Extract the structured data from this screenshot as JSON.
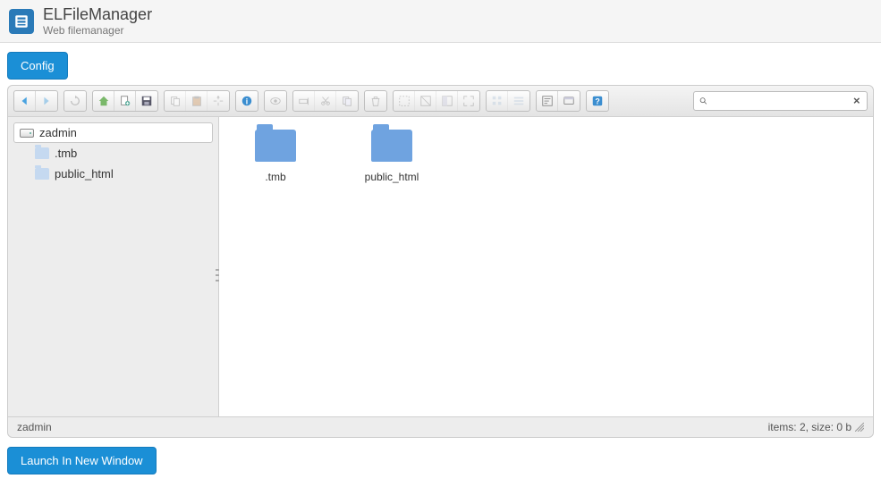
{
  "app": {
    "title": "ELFileManager",
    "subtitle": "Web filemanager"
  },
  "buttons": {
    "config": "Config",
    "launch": "Launch In New Window"
  },
  "toolbar": {
    "groups": [
      [
        {
          "name": "back-icon",
          "svg": "arrow-left",
          "enabled": true
        },
        {
          "name": "forward-icon",
          "svg": "arrow-right",
          "enabled": false
        }
      ],
      [
        {
          "name": "reload-icon",
          "svg": "reload",
          "enabled": false
        }
      ],
      [
        {
          "name": "home-icon",
          "svg": "home",
          "enabled": true
        },
        {
          "name": "new-file-icon",
          "svg": "newfile",
          "enabled": true
        },
        {
          "name": "save-icon",
          "svg": "save",
          "enabled": true
        }
      ],
      [
        {
          "name": "copy-icon",
          "svg": "copy",
          "enabled": false
        },
        {
          "name": "paste-icon",
          "svg": "paste",
          "enabled": false
        },
        {
          "name": "move-icon",
          "svg": "move",
          "enabled": false
        }
      ],
      [
        {
          "name": "info-icon",
          "svg": "info",
          "enabled": true
        }
      ],
      [
        {
          "name": "preview-icon",
          "svg": "eye",
          "enabled": false
        }
      ],
      [
        {
          "name": "rename-icon",
          "svg": "rename",
          "enabled": false
        },
        {
          "name": "cut-icon",
          "svg": "cut",
          "enabled": false
        },
        {
          "name": "duplicate-icon",
          "svg": "dup",
          "enabled": false
        }
      ],
      [
        {
          "name": "delete-icon",
          "svg": "trash",
          "enabled": false
        }
      ],
      [
        {
          "name": "select-all-icon",
          "svg": "selall",
          "enabled": false
        },
        {
          "name": "select-none-icon",
          "svg": "selnone",
          "enabled": false
        },
        {
          "name": "invert-selection-icon",
          "svg": "selinv",
          "enabled": false
        },
        {
          "name": "fullscreen-icon",
          "svg": "full",
          "enabled": false
        }
      ],
      [
        {
          "name": "view-icons-icon",
          "svg": "grid",
          "enabled": false
        },
        {
          "name": "view-list-icon",
          "svg": "list",
          "enabled": false
        }
      ],
      [
        {
          "name": "sort-icon",
          "svg": "sort",
          "enabled": true
        },
        {
          "name": "view-mode-icon",
          "svg": "view",
          "enabled": true
        }
      ],
      [
        {
          "name": "help-icon",
          "svg": "help",
          "enabled": true
        }
      ]
    ],
    "search_placeholder": ""
  },
  "tree": {
    "root": "zadmin",
    "items": [
      {
        "label": ".tmb"
      },
      {
        "label": "public_html"
      }
    ]
  },
  "files": [
    {
      "label": ".tmb"
    },
    {
      "label": "public_html"
    }
  ],
  "status": {
    "path": "zadmin",
    "right": "items: 2, size: 0 b"
  }
}
